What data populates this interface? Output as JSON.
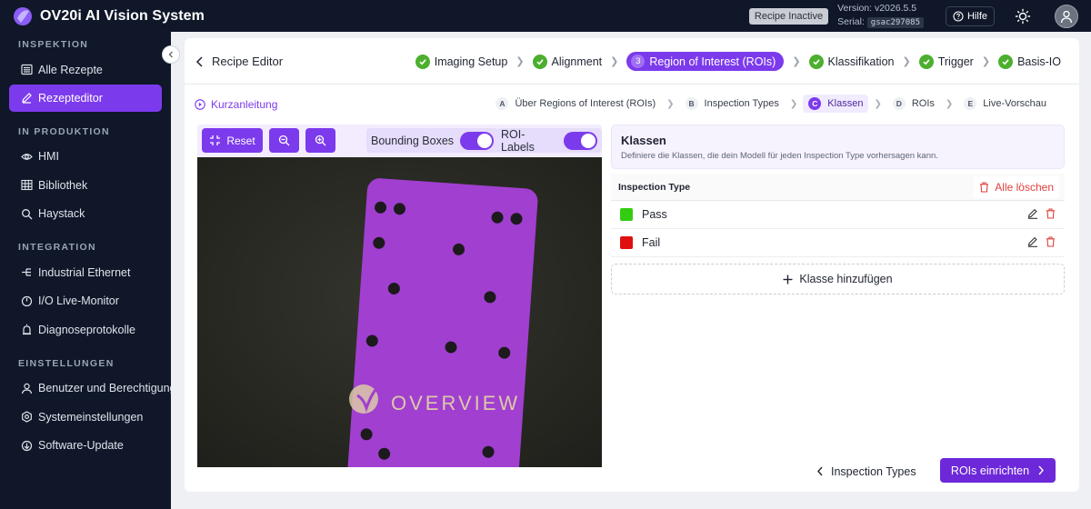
{
  "header": {
    "app_title": "OV20i AI Vision System",
    "recipe_status": "Recipe Inactive",
    "version": "Version: v2026.5.5",
    "serial_label": "Serial:",
    "serial_value": "gsac297085",
    "help_label": "Hilfe",
    "icons": [
      "logo-icon",
      "help-icon",
      "sun-icon",
      "user-icon"
    ]
  },
  "sidebar": {
    "sections": [
      {
        "title": "INSPEKTION",
        "items": [
          {
            "label": "Alle Rezepte",
            "icon": "list-icon"
          },
          {
            "label": "Rezepteditor",
            "icon": "edit-icon",
            "active": true
          }
        ]
      },
      {
        "title": "IN PRODUKTION",
        "items": [
          {
            "label": "HMI",
            "icon": "eye-icon"
          },
          {
            "label": "Bibliothek",
            "icon": "grid-icon"
          },
          {
            "label": "Haystack",
            "icon": "search-icon"
          }
        ]
      },
      {
        "title": "INTEGRATION",
        "items": [
          {
            "label": "Industrial Ethernet",
            "icon": "network-icon"
          },
          {
            "label": "I/O Live-Monitor",
            "icon": "monitor-icon"
          },
          {
            "label": "Diagnoseprotokolle",
            "icon": "alarm-icon"
          }
        ]
      },
      {
        "title": "EINSTELLUNGEN",
        "items": [
          {
            "label": "Benutzer und Berechtigungen",
            "icon": "user-icon"
          },
          {
            "label": "Systemeinstellungen",
            "icon": "gear-icon"
          },
          {
            "label": "Software-Update",
            "icon": "refresh-icon"
          }
        ]
      }
    ]
  },
  "editor": {
    "back_label": "Recipe Editor",
    "steps": [
      {
        "label": "Imaging Setup",
        "status": "done"
      },
      {
        "label": "Alignment",
        "status": "done"
      },
      {
        "label": "Region of Interest (ROIs)",
        "status": "active",
        "number": "3"
      },
      {
        "label": "Klassifikation",
        "status": "done"
      },
      {
        "label": "Trigger",
        "status": "done"
      },
      {
        "label": "Basis-IO",
        "status": "done"
      }
    ],
    "quickguide_label": "Kurzanleitung",
    "substeps": [
      {
        "letter": "A",
        "label": "Über Regions of Interest (ROIs)"
      },
      {
        "letter": "B",
        "label": "Inspection Types"
      },
      {
        "letter": "C",
        "label": "Klassen",
        "active": true
      },
      {
        "letter": "D",
        "label": "ROIs"
      },
      {
        "letter": "E",
        "label": "Live-Vorschau"
      }
    ]
  },
  "image_toolbar": {
    "reset_label": "Reset",
    "bounding_boxes_label": "Bounding Boxes",
    "bounding_boxes_on": true,
    "roi_labels_label": "ROI-Labels",
    "roi_labels_on": true
  },
  "image": {
    "part_text": "OVERVIEW",
    "part_color": "#a13fd0"
  },
  "classes": {
    "title": "Klassen",
    "description": "Definiere die Klassen, die dein Modell für jeden Inspection Type vorhersagen kann.",
    "column_header": "Inspection Type",
    "clear_all_label": "Alle löschen",
    "rows": [
      {
        "name": "Pass",
        "color": "#33cc11"
      },
      {
        "name": "Fail",
        "color": "#e01010"
      }
    ],
    "add_label": "Klasse hinzufügen"
  },
  "footer": {
    "back_label": "Inspection Types",
    "next_label": "ROIs einrichten"
  },
  "colors": {
    "accent": "#7c3aed",
    "nav_bg": "#0f1729",
    "success": "#4caf2e",
    "danger": "#e0403d"
  }
}
